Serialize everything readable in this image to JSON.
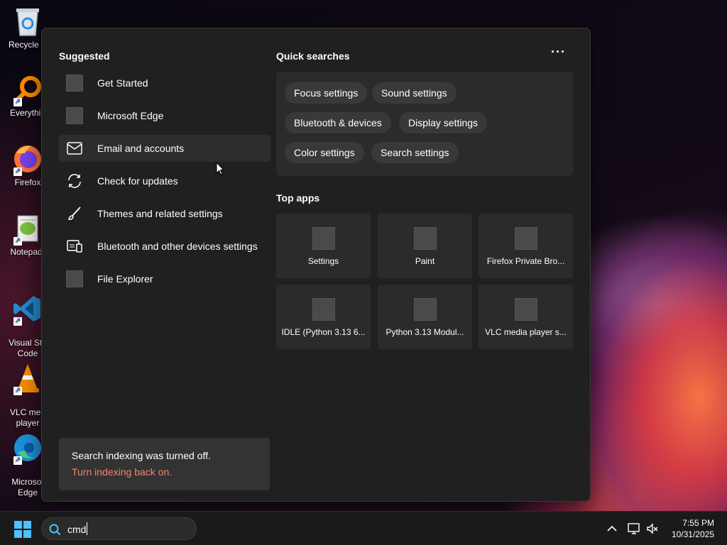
{
  "desktop": {
    "icons": [
      {
        "label": "Recycle B",
        "icon": "recycle-bin-icon"
      },
      {
        "label": "Everythin",
        "icon": "everything-search-icon"
      },
      {
        "label": "Firefox",
        "icon": "firefox-icon"
      },
      {
        "label": "Notepad-",
        "icon": "notepad-plus-plus-icon"
      },
      {
        "label": "Visual Stu\nCode",
        "icon": "vscode-icon"
      },
      {
        "label": "VLC med\nplayer",
        "icon": "vlc-icon"
      },
      {
        "label": "Microsof\nEdge",
        "icon": "edge-icon"
      }
    ]
  },
  "panel": {
    "suggested_title": "Suggested",
    "suggested": [
      {
        "label": "Get Started",
        "icon": "placeholder-icon"
      },
      {
        "label": "Microsoft Edge",
        "icon": "placeholder-icon"
      },
      {
        "label": "Email and accounts",
        "icon": "mail-icon"
      },
      {
        "label": "Check for updates",
        "icon": "sync-icon"
      },
      {
        "label": "Themes and related settings",
        "icon": "brush-icon"
      },
      {
        "label": "Bluetooth and other devices settings",
        "icon": "devices-icon"
      },
      {
        "label": "File Explorer",
        "icon": "placeholder-icon"
      }
    ],
    "quick_title": "Quick searches",
    "more_label": "···",
    "quick_searches": [
      "Focus settings",
      "Sound settings",
      "Bluetooth & devices",
      "Display settings",
      "Color settings",
      "Search settings"
    ],
    "top_apps_title": "Top apps",
    "top_apps": [
      "Settings",
      "Paint",
      "Firefox Private Bro...",
      "IDLE (Python 3.13 6...",
      "Python 3.13 Modul...",
      "VLC media player s..."
    ],
    "indexing_message": "Search indexing was turned off.",
    "indexing_link": "Turn indexing back on."
  },
  "taskbar": {
    "search_value": "cmd",
    "time": "7:55 PM",
    "date": "10/31/2025",
    "tray_icons": [
      "chevron-up-icon",
      "network-icon",
      "volume-muted-icon"
    ]
  },
  "colors": {
    "panel_bg": "#202020",
    "accent_link": "#f0846c",
    "windows_blue": "#4cc2ff"
  }
}
